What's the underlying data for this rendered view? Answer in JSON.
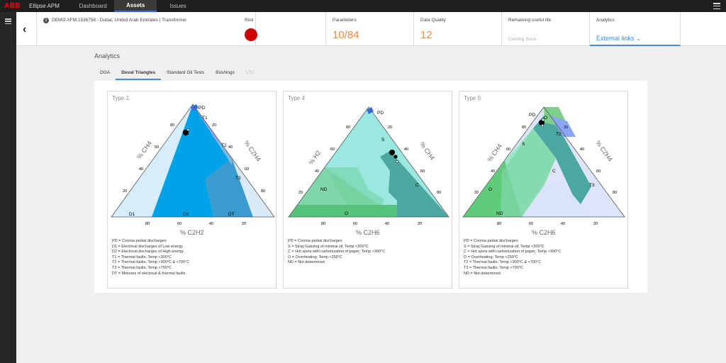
{
  "topbar": {
    "logo": "ABB",
    "app_title": "Ellipse APM",
    "tabs": [
      {
        "label": "Dashboard"
      },
      {
        "label": "Assets"
      },
      {
        "label": "Issues"
      }
    ]
  },
  "header": {
    "asset": "DEMO.XFM.1536758 - Dubai, United Arab Emirates | Transformer",
    "risk_label": "Risk",
    "risk_color": "#cc0000",
    "parameters_label": "Parameters",
    "parameters_value": "10/84",
    "dq_label": "Data Quality",
    "dq_value": "12",
    "rul_label": "Remaining useful life",
    "rul_value": "Coming Soon",
    "analytics_label": "Analytics",
    "external_links": "External links"
  },
  "main": {
    "title": "Analytics",
    "tabs": [
      {
        "label": "DGA"
      },
      {
        "label": "Duval Triangles"
      },
      {
        "label": "Standard Oil Tests"
      },
      {
        "label": "Bushings"
      },
      {
        "label": "LTC"
      }
    ]
  },
  "triangles": [
    {
      "title": "Type 1",
      "left_axis": "% CH4",
      "right_axis": "% C2H4",
      "bottom_axis": "% C2H2",
      "zones": [
        "PD",
        "T1",
        "T2",
        "T3",
        "D1",
        "D2",
        "DT"
      ],
      "legend": [
        "PD = Corona partial discharges",
        "D1 = Electrical discharges of Low energy",
        "D2 = Electrical discharges of High energy",
        "T1 = Thermal faults; Temp <300°C",
        "T2 = Thermal faults; Temp >300°C & <700°C",
        "T3 = Thermal faults; Temp >700°C",
        "DT = Mixtures of electrical & thermal faults"
      ]
    },
    {
      "title": "Type 4",
      "left_axis": "% H2",
      "right_axis": "% CH4",
      "bottom_axis": "% C2H6",
      "zones": [
        "PD",
        "S",
        "C",
        "ND",
        "O"
      ],
      "legend": [
        "PD = Corona partial discharges",
        "S   = Stray Gassing of mineral oil; Temp <200°C",
        "C   = Hot spots with carbonization of paper; Temp >300°C",
        "O   = Overheating; Temp <250°C",
        "ND = Not determined"
      ]
    },
    {
      "title": "Type 5",
      "left_axis": "% CH4",
      "right_axis": "% C2H4",
      "bottom_axis": "% C2H6",
      "zones": [
        "PD",
        "O",
        "S",
        "T2",
        "C",
        "O",
        "ND",
        "T3"
      ],
      "legend": [
        "PD = Corona partial discharges",
        "S   = Stray Gassing of mineral oil; Temp <200°C",
        "C   = Hot spots with carbonization of paper; Temp >300°C",
        "O   = Overheating; Temp <250°C",
        "T2 = Thermal faults; Temp >300°C & <700°C",
        "T3 = Thermal faults; Temp >700°C",
        "ND = Not determined"
      ]
    }
  ],
  "ticks": {
    "left": [
      "80",
      "60",
      "40",
      "20"
    ],
    "right": [
      "20",
      "40",
      "60",
      "80"
    ],
    "bottom": [
      "80",
      "60",
      "40",
      "20"
    ]
  }
}
